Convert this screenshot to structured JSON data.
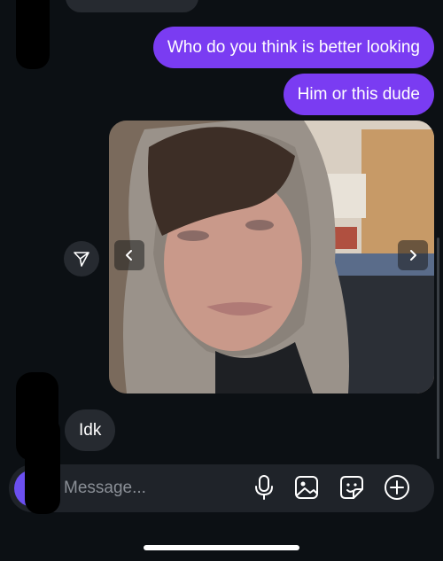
{
  "conversation": {
    "messages": [
      {
        "direction": "outgoing",
        "text": "Who do you think is better looking"
      },
      {
        "direction": "outgoing",
        "text": "Him or this dude"
      },
      {
        "direction": "incoming",
        "text": "Idk"
      }
    ]
  },
  "photo_message": {
    "icons": {
      "previous": "chevron-left-icon",
      "next": "chevron-right-icon",
      "share": "send-icon"
    }
  },
  "composer": {
    "placeholder": "Message...",
    "icons": [
      "camera-icon",
      "microphone-icon",
      "gallery-icon",
      "sticker-icon",
      "plus-icon"
    ]
  },
  "colors": {
    "background": "#0c1014",
    "outgoing_bubble": "#7a3cf2",
    "incoming_bubble": "#262a30",
    "composer": "#1f2329",
    "camera_button": "#6b4ff0"
  }
}
